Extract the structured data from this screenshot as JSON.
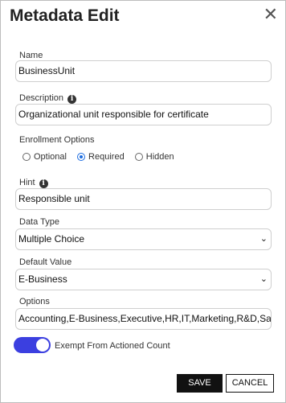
{
  "dialog": {
    "title": "Metadata Edit",
    "close_symbol": "✕"
  },
  "name": {
    "label": "Name",
    "value": "BusinessUnit"
  },
  "description": {
    "label": "Description",
    "value": "Organizational unit responsible for certificate"
  },
  "enrollment": {
    "label": "Enrollment Options",
    "options": [
      "Optional",
      "Required",
      "Hidden"
    ],
    "selected": "Required"
  },
  "hint": {
    "label": "Hint",
    "value": "Responsible unit"
  },
  "data_type": {
    "label": "Data Type",
    "value": "Multiple Choice"
  },
  "default_value": {
    "label": "Default Value",
    "value": "E-Business"
  },
  "options": {
    "label": "Options",
    "value": "Accounting,E-Business,Executive,HR,IT,Marketing,R&D,Sales"
  },
  "exempt": {
    "label": "Exempt From Actioned Count",
    "enabled": true,
    "color": "#3b3fe0"
  },
  "buttons": {
    "save": "SAVE",
    "cancel": "CANCEL"
  },
  "icons": {
    "info": "info-icon",
    "chevron": "chevron-down-icon",
    "close": "close-icon"
  }
}
